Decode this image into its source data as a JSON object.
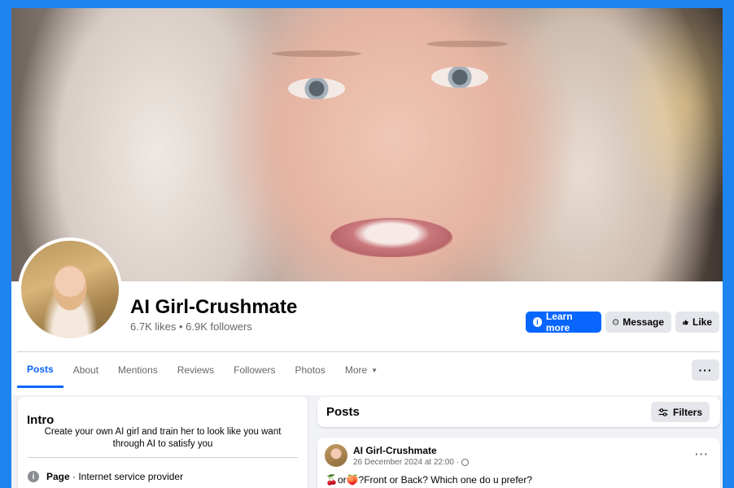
{
  "page": {
    "name": "AI Girl-Crushmate",
    "stats": "6.7K likes • 6.9K followers"
  },
  "actions": {
    "learn_more": "Learn more",
    "message": "Message",
    "like": "Like"
  },
  "tabs": [
    "Posts",
    "About",
    "Mentions",
    "Reviews",
    "Followers",
    "Photos",
    "More"
  ],
  "active_tab": "Posts",
  "icons": {
    "learn_more": "info-icon",
    "message": "messenger-icon",
    "like": "thumbs-up-icon",
    "more": "more-dots-icon",
    "filters": "sliders-icon",
    "privacy": "globe-icon",
    "category": "info-icon"
  },
  "intro": {
    "title": "Intro",
    "description": "Create your own AI girl and train her to look like you want through AI to satisfy you",
    "page_label": "Page",
    "category": " · Internet service provider"
  },
  "posts_section": {
    "title": "Posts",
    "filters_label": "Filters"
  },
  "post": {
    "author": "AI Girl-Crushmate",
    "date": "26 December 2024 at 22:00 ·",
    "text": "🍒or🍑?Front or Back? Which one do u prefer?"
  },
  "colors": {
    "accent": "#0866ff",
    "frame": "#1e85f0",
    "background": "#f0f2f5",
    "secondary_button": "#e4e6eb",
    "muted_text": "#65676b"
  }
}
